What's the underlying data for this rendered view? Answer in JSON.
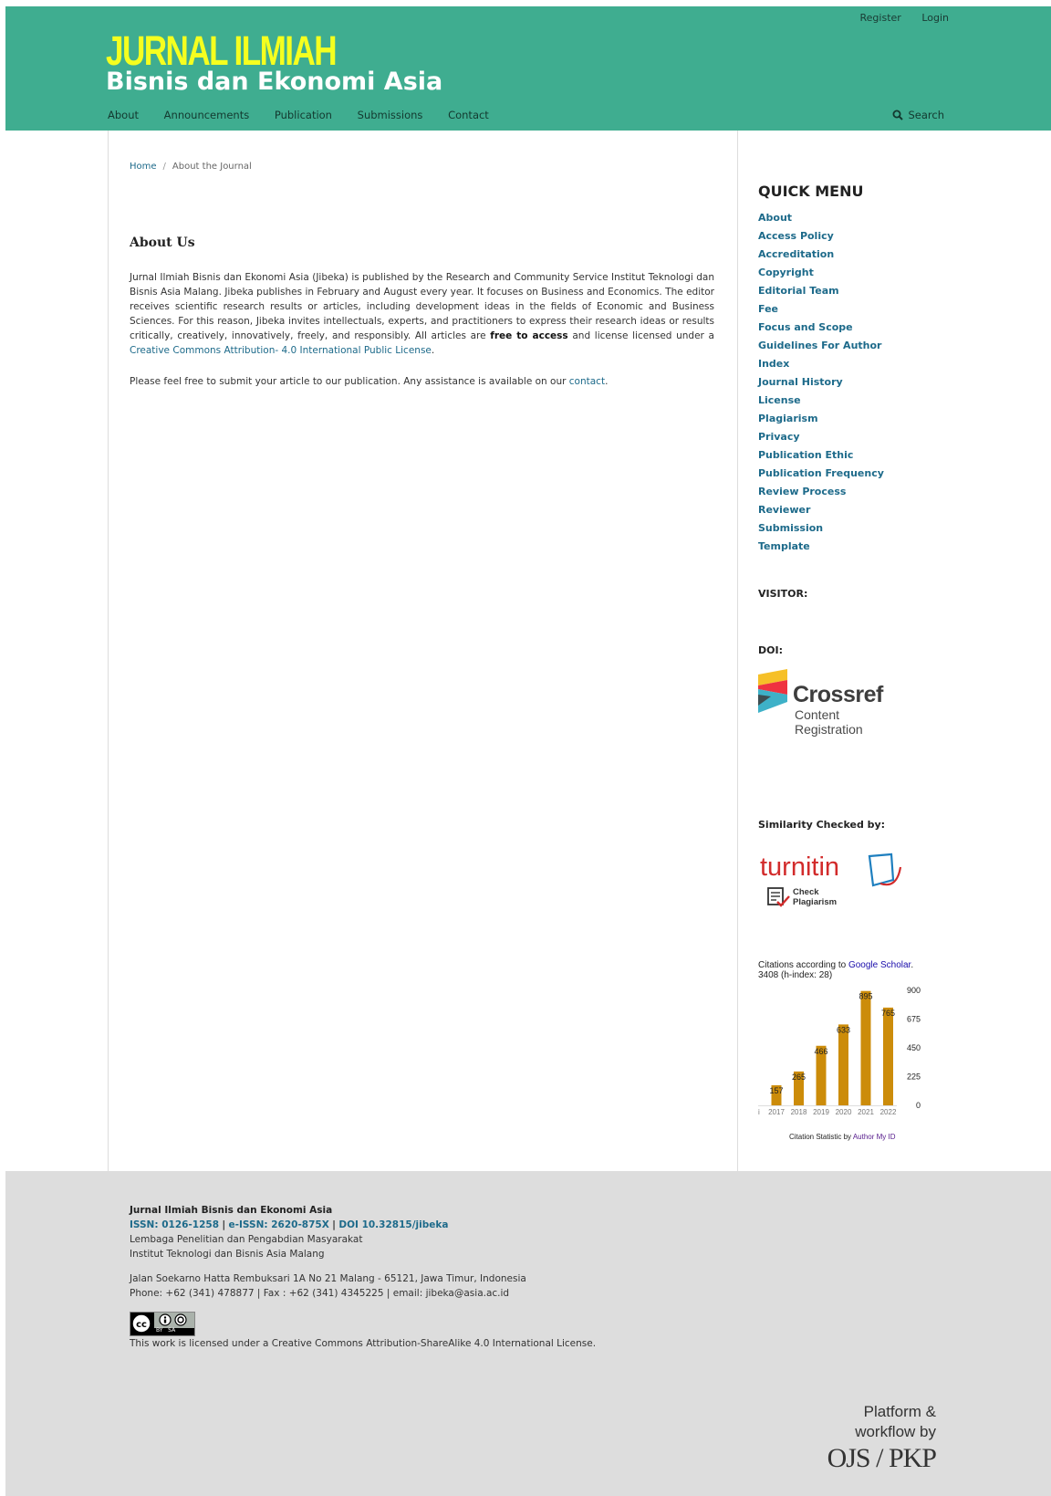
{
  "header": {
    "user_nav": [
      "Register",
      "Login"
    ],
    "logo_line1": "JURNAL ILMIAH",
    "logo_line2": "Bisnis dan Ekonomi Asia",
    "nav": [
      "About",
      "Announcements",
      "Publication",
      "Submissions",
      "Contact"
    ],
    "search_label": "Search"
  },
  "breadcrumb": {
    "home": "Home",
    "separator": "/",
    "current": "About the Journal"
  },
  "main": {
    "title": "About Us",
    "para1_a": "Jurnal Ilmiah Bisnis dan Ekonomi Asia (Jibeka) is published by the Research and Community Service Institut Teknologi dan Bisnis Asia Malang.  Jibeka publishes in February and August every year. It focuses on Business and Economics.  The editor receives scientific research results or articles, including development ideas in the fields of Economic and Business Sciences. For this reason, Jibeka invites intellectuals, experts, and practitioners to express their research ideas or results critically, creatively, innovatively, freely, and responsibly. All articles are ",
    "para1_bold": "free to access",
    "para1_b": " and license licensed under a",
    "para1_link": " Creative Commons Attribution- 4.0 International Public License",
    "para1_end": ".",
    "para2_a": "Please feel free to submit your article to our publication. Any assistance is available on our ",
    "para2_link": "contact",
    "para2_end": "."
  },
  "sidebar": {
    "quick_menu_title": "QUICK MENU",
    "quick_menu": [
      "About",
      "Access Policy",
      "Accreditation",
      "Copyright",
      "Editorial Team",
      "Fee",
      "Focus and Scope",
      "Guidelines For Author",
      "Index",
      "Journal History",
      "License",
      "Plagiarism",
      "Privacy",
      "Publication Ethic",
      "Publication Frequency",
      "Review Process",
      "Reviewer",
      "Submission",
      "Template"
    ],
    "visitor_label": "VISITOR:",
    "doi_label": "DOI:",
    "crossref_name": "Crossref",
    "crossref_line2": "Content",
    "crossref_line3": "Registration",
    "similarity_label": "Similarity Checked by:",
    "turnitin_name": "turnitin",
    "turnitin_sub1": "Check",
    "turnitin_sub2": "Plagiarism",
    "citations_prefix": "Citations according to ",
    "citations_link": "Google Scholar",
    "citations_suffix": ".",
    "citations_total": "3408 (h-index: 28)",
    "citation_footer_prefix": "Citation Statistic by ",
    "citation_footer_link": "Author My ID"
  },
  "colors": {
    "header_bg": "#3fad90",
    "logo_yellow": "#f5ff1f",
    "link_blue": "#1d6a8a",
    "bar_color": "#cc8c0a",
    "footer_bg": "#dddddd"
  },
  "chart_data": {
    "type": "bar",
    "title": "",
    "categories": [
      "2017",
      "2018",
      "2019",
      "2020",
      "2021",
      "2022"
    ],
    "values": [
      157,
      265,
      466,
      633,
      895,
      765
    ],
    "ylim": [
      0,
      900
    ],
    "yticks": [
      "900",
      "675",
      "450",
      "225",
      "0"
    ],
    "ytick_values": [
      900,
      675,
      450,
      225,
      0
    ],
    "data_labels": [
      "157",
      "265",
      "466",
      "633",
      "895",
      "765"
    ],
    "grid": false,
    "cut_first_label": "i"
  },
  "footer": {
    "journal_name": "Jurnal Ilmiah Bisnis dan Ekonomi Asia",
    "issn": "ISSN: 0126-1258",
    "eissn": "e-ISSN: 2620-875X",
    "doi": "DOI 10.32815/jibeka",
    "separator": "|",
    "org1": "Lembaga Penelitian dan Pengabdian Masyarakat",
    "org2": "Institut Teknologi dan Bisnis Asia Malang",
    "address": "Jalan Soekarno Hatta Rembuksari 1A  No 21 Malang - 65121, Jawa Timur, Indonesia",
    "contact": "Phone: +62 (341) 478877 | Fax : +62 (341) 4345225 | email: jibeka@asia.ac.id",
    "license_link": "This work is licensed under a Creative Commons Attribution-ShareAlike 4.0 International License.",
    "cc_label": "BY   SA",
    "pkp_line1": "Platform &",
    "pkp_line2": "workflow by",
    "pkp_line3": "OJS / PKP"
  }
}
